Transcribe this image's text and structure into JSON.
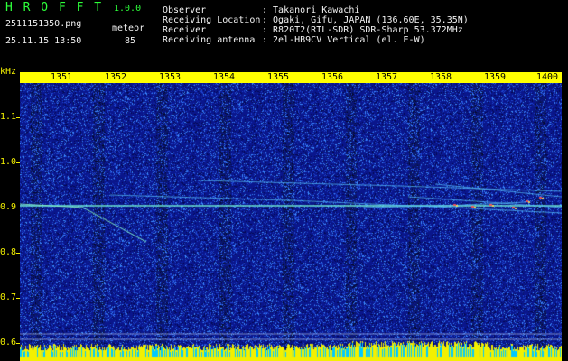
{
  "header": {
    "app_name": "H R O F F T",
    "version": "1.0.0",
    "filename": "2511151350.png",
    "mode": "meteor",
    "datetime": "25.11.15 13:50",
    "count": "85",
    "info_labels": [
      "Observer",
      "Receiving Location",
      "Receiver",
      "Receiving antenna"
    ],
    "info_values": [
      ": Takanori Kawachi",
      ": Ogaki, Gifu, JAPAN (136.60E, 35.35N)",
      ": R820T2(RTL-SDR) SDR-Sharp 53.372MHz",
      ": 2el-HB9CV Vertical (el. E-W)"
    ]
  },
  "axes": {
    "y_unit": "kHz",
    "y_labels": [
      "1.1",
      "1.0",
      "0.9",
      "0.8",
      "0.7",
      "0.6"
    ],
    "x_labels": [
      "1351",
      "1352",
      "1353",
      "1354",
      "1355",
      "1356",
      "1357",
      "1358",
      "1359",
      "1400"
    ]
  },
  "colors": {
    "text_green": "#2dff3a",
    "text_white": "#f2f2f2",
    "axis_yellow": "#f3f000",
    "background": "#000000",
    "noise_blue": "#1a2aa8"
  }
}
